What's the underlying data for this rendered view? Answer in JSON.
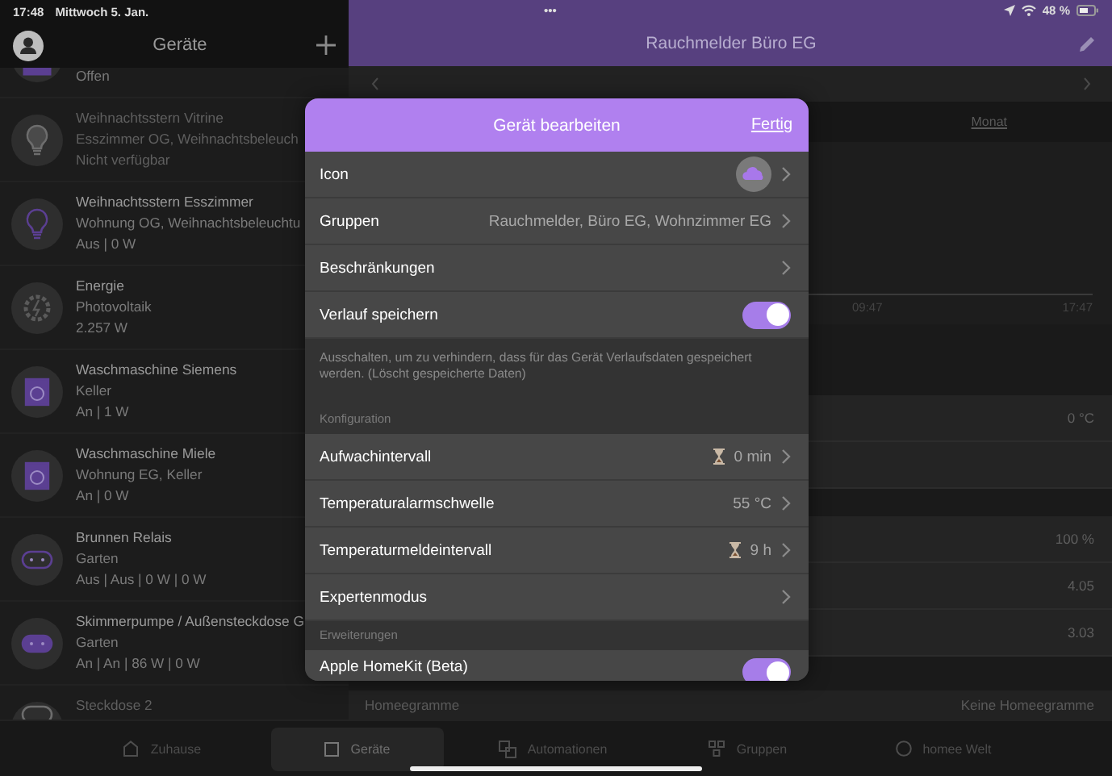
{
  "status_bar": {
    "time": "17:48",
    "date": "Mittwoch 5. Jan.",
    "dots": "•••",
    "battery": "48 %"
  },
  "devices": {
    "title": "Geräte",
    "items": [
      {
        "kind": "shutter",
        "on": true,
        "available": true,
        "lines": [
          "Offen"
        ]
      },
      {
        "kind": "bulb",
        "on": false,
        "available": false,
        "lines": [
          "Weihnachtsstern Vitrine",
          "Esszimmer OG, Weihnachtsbeleuch",
          "Nicht verfügbar"
        ]
      },
      {
        "kind": "bulb",
        "on": false,
        "available": true,
        "lines": [
          "Weihnachtsstern Esszimmer",
          "Wohnung OG, Weihnachtsbeleuchtu",
          "Aus | 0 W"
        ]
      },
      {
        "kind": "energy",
        "on": false,
        "available": true,
        "lines": [
          "Energie",
          "Photovoltaik",
          "2.257 W"
        ]
      },
      {
        "kind": "washer",
        "on": true,
        "available": true,
        "lines": [
          "Waschmaschine Siemens",
          "Keller",
          "An | 1 W"
        ]
      },
      {
        "kind": "washer",
        "on": true,
        "available": true,
        "lines": [
          "Waschmaschine Miele",
          "Wohnung EG, Keller",
          "An | 0 W"
        ]
      },
      {
        "kind": "socket",
        "on": false,
        "available": true,
        "lines": [
          "Brunnen Relais",
          "Garten",
          "Aus | Aus | 0 W | 0 W"
        ]
      },
      {
        "kind": "socket",
        "on": true,
        "available": true,
        "lines": [
          "Skimmerpumpe / Außensteckdose G",
          "Garten",
          "An | An | 86 W | 0 W"
        ]
      },
      {
        "kind": "socket",
        "on": false,
        "available": false,
        "lines": [
          "Steckdose 2"
        ]
      }
    ]
  },
  "detail": {
    "title": "Rauchmelder Büro EG",
    "period_link": "Monat",
    "chart_labels": [
      "09:47",
      "17:47"
    ],
    "groups": [
      [
        {
          "kind": "value",
          "value": "0 °C"
        },
        {
          "kind": "blank"
        }
      ],
      [
        {
          "kind": "value",
          "value": "100 %"
        },
        {
          "kind": "value",
          "value": "4.05"
        },
        {
          "kind": "value",
          "value": "3.03"
        }
      ]
    ],
    "homeegrams": {
      "label": "Homeegramme",
      "value": "Keine Homeegramme"
    }
  },
  "edit_dialog": {
    "title": "Gerät bearbeiten",
    "done": "Fertig",
    "sections": [
      {
        "rows": [
          {
            "kind": "icon",
            "label": "Icon"
          },
          {
            "kind": "value",
            "label": "Gruppen",
            "value": "Rauchmelder, Büro EG, Wohnzimmer EG"
          },
          {
            "kind": "link",
            "label": "Beschränkungen"
          },
          {
            "kind": "toggle",
            "label": "Verlauf speichern",
            "on": true
          }
        ],
        "footer": "Ausschalten, um zu verhindern, dass für das Gerät Verlaufsdaten gespeichert werden. (Löscht gespeicherte Daten)"
      },
      {
        "header": "Konfiguration",
        "rows": [
          {
            "kind": "timer",
            "label": "Aufwachintervall",
            "value": "0 min"
          },
          {
            "kind": "value",
            "label": "Temperaturalarmschwelle",
            "value": "55 °C"
          },
          {
            "kind": "timer",
            "label": "Temperaturmeldeintervall",
            "value": "9 h"
          },
          {
            "kind": "link",
            "label": "Expertenmodus"
          }
        ]
      },
      {
        "header": "Erweiterungen",
        "rows": [
          {
            "kind": "toggle",
            "label": "Apple HomeKit (Beta)",
            "on": true
          }
        ]
      }
    ]
  },
  "tab_bar": [
    {
      "kind": "home",
      "label": "Zuhause",
      "selected": false
    },
    {
      "kind": "devices",
      "label": "Geräte",
      "selected": true
    },
    {
      "kind": "automations",
      "label": "Automationen",
      "selected": false
    },
    {
      "kind": "groups",
      "label": "Gruppen",
      "selected": false
    },
    {
      "kind": "world",
      "label": "homee Welt",
      "selected": false
    }
  ]
}
